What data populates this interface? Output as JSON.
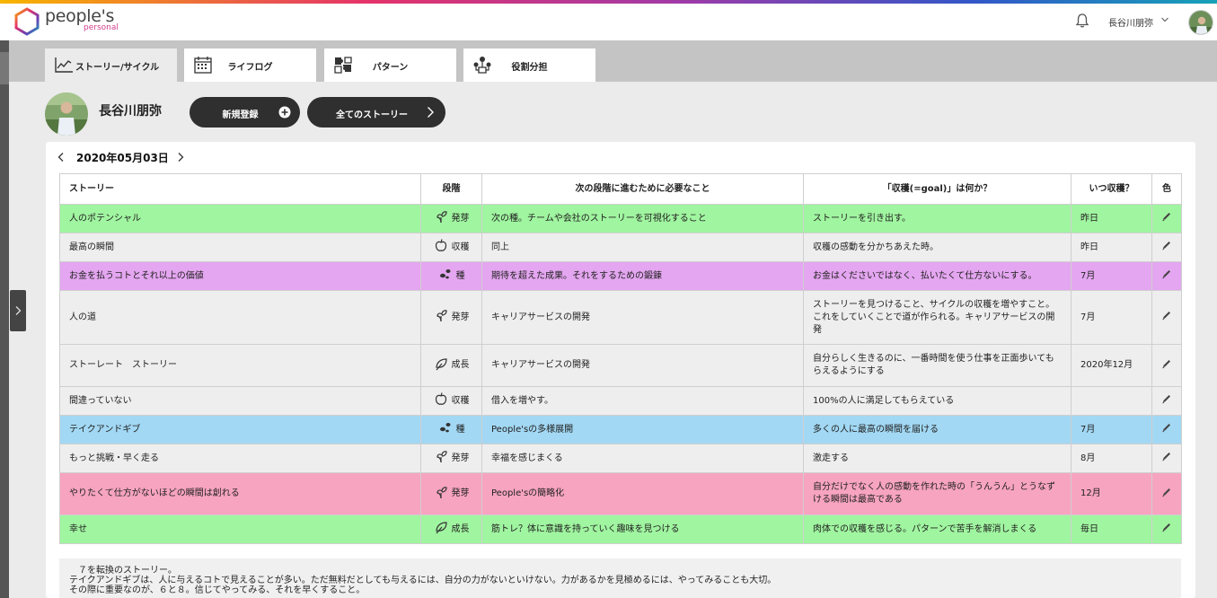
{
  "brand": {
    "name": "people's",
    "sub": "personal"
  },
  "header": {
    "user_name": "長谷川朋弥"
  },
  "tabs": [
    {
      "label": "ストーリー/サイクル",
      "icon": "chart-line-icon"
    },
    {
      "label": "ライフログ",
      "icon": "calendar-icon"
    },
    {
      "label": "パターン",
      "icon": "puzzle-icon"
    },
    {
      "label": "役割分担",
      "icon": "team-icon"
    }
  ],
  "profile": {
    "name": "長谷川朋弥",
    "new_button": "新規登録",
    "all_button": "全てのストーリー"
  },
  "date": {
    "label": "2020年05月03日"
  },
  "table": {
    "headers": [
      "ストーリー",
      "段階",
      "次の段階に進むために必要なこと",
      "「収穫(=goal)」は何か？",
      "いつ収穫？",
      "色"
    ],
    "rows": [
      {
        "story": "人のポテンシャル",
        "stage": "発芽",
        "stage_icon": "sprout-icon",
        "next": "次の種。チームや会社のストーリーを可視化すること",
        "goal": "ストーリーを引き出す。",
        "when": "昨日",
        "color": "#a0f5a0"
      },
      {
        "story": "最高の瞬間",
        "stage": "収穫",
        "stage_icon": "apple-icon",
        "next": "同上",
        "goal": "収穫の感動を分かちあえた時。",
        "when": "昨日",
        "color": "#eeeeee"
      },
      {
        "story": "お金を払うコトとそれ以上の価値",
        "stage": "種",
        "stage_icon": "seed-icon",
        "next": "期待を超えた成果。それをするための鍛錬",
        "goal": "お金はくださいではなく、払いたくて仕方ないにする。",
        "when": "7月",
        "color": "#e4a6f0"
      },
      {
        "story": "人の道",
        "stage": "発芽",
        "stage_icon": "sprout-icon",
        "next": "キャリアサービスの開発",
        "goal": "ストーリーを見つけること、サイクルの収穫を増やすこと。これをしていくことで道が作られる。キャリアサービスの開発",
        "when": "7月",
        "color": "#eeeeee"
      },
      {
        "story": "ストーレート　ストーリー",
        "stage": "成長",
        "stage_icon": "leaf-icon",
        "next": "キャリアサービスの開発",
        "goal": "自分らしく生きるのに、一番時間を使う仕事を正面歩いてもらえるようにする",
        "when": "2020年12月",
        "color": "#eeeeee"
      },
      {
        "story": "間違っていない",
        "stage": "収穫",
        "stage_icon": "apple-icon",
        "next": "借入を増やす。",
        "goal": "100%の人に満足してもらえている",
        "when": "",
        "color": "#eeeeee"
      },
      {
        "story": "テイクアンドギブ",
        "stage": "種",
        "stage_icon": "seed-icon",
        "next": "People'sの多様展開",
        "goal": "多くの人に最高の瞬間を届ける",
        "when": "7月",
        "color": "#a2d8f4"
      },
      {
        "story": "もっと挑戦・早く走る",
        "stage": "発芽",
        "stage_icon": "sprout-icon",
        "next": "幸福を感じまくる",
        "goal": "激走する",
        "when": "8月",
        "color": "#eeeeee"
      },
      {
        "story": "やりたくて仕方がないほどの瞬間は創れる",
        "stage": "発芽",
        "stage_icon": "sprout-icon",
        "next": "People'sの簡略化",
        "goal": "自分だけでなく人の感動を作れた時の「うんうん」とうなずける瞬間は最高である",
        "when": "12月",
        "color": "#f7a4c0"
      },
      {
        "story": "幸せ",
        "stage": "成長",
        "stage_icon": "leaf-icon",
        "next": "筋トレ？体に意識を持っていく趣味を見つける",
        "goal": "肉体での収穫を感じる。パターンで苦手を解消しまくる",
        "when": "毎日",
        "color": "#a0f5a0"
      }
    ]
  },
  "memo": {
    "lines": [
      "　７を転換のストーリー。",
      "テイクアンドギブは、人に与えるコトで見えることが多い。ただ無料だとしても与えるには、自分の力がないといけない。力があるかを見極めるには、やってみることも大切。",
      "その際に重要なのが、６と８。信じてやってみる、それを早くすること。"
    ]
  }
}
